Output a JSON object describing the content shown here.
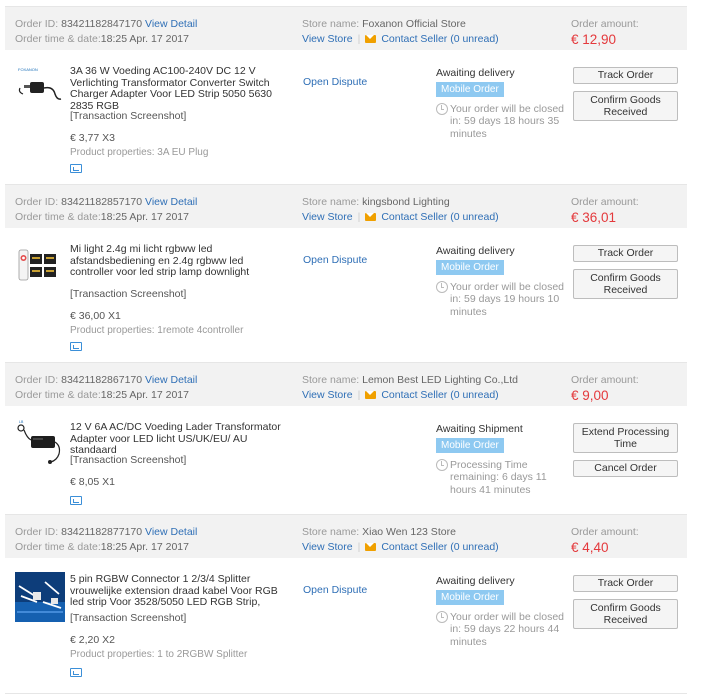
{
  "labels": {
    "order_id": "Order ID:",
    "order_time": "Order time & date:",
    "store_name": "Store name:",
    "view_detail": "View Detail",
    "view_store": "View Store",
    "contact_seller": "Contact Seller",
    "unread_open": "(",
    "unread_close": " unread)",
    "order_amount": "Order amount:",
    "transaction_screenshot": "[Transaction Screenshot]"
  },
  "orders": [
    {
      "order_id": "83421182847170",
      "order_time": "18:25 Apr. 17 2017",
      "store": "Foxanon Official Store",
      "unread": "0",
      "amount": "€ 12,90",
      "product_title": "3A 36 W Voeding AC100-240V DC 12 V Verlichting Transformator Converter Switch Charger Adapter Voor LED Strip 5050 5630 2835 RGB",
      "price_qty": "€ 3,77 X3",
      "properties": "Product properties: 3A EU Plug",
      "dispute": "Open Dispute",
      "status": "Awaiting delivery",
      "badge": "Mobile Order",
      "countdown": "Your order will be closed in: 59 days 18 hours 35 minutes",
      "button1": "Track Order",
      "button2": "Confirm Goods Received"
    },
    {
      "order_id": "83421182857170",
      "order_time": "18:25 Apr. 17 2017",
      "store": "kingsbond Lighting",
      "unread": "0",
      "amount": "€ 36,01",
      "product_title": "Mi light 2.4g mi licht rgbww led afstandsbediening en 2.4g rgbww led controller voor led strip lamp downlight",
      "price_qty": "€ 36,00 X1",
      "properties": "Product properties: 1remote 4controller",
      "dispute": "Open Dispute",
      "status": "Awaiting delivery",
      "badge": "Mobile Order",
      "countdown": "Your order will be closed in: 59 days 19 hours 10 minutes",
      "button1": "Track Order",
      "button2": "Confirm Goods Received"
    },
    {
      "order_id": "83421182867170",
      "order_time": "18:25 Apr. 17 2017",
      "store": "Lemon Best LED Lighting Co.,Ltd",
      "unread": "0",
      "amount": "€ 9,00",
      "product_title": "12 V 6A AC/DC Voeding Lader Transformator Adapter voor LED licht US/UK/EU/ AU standaard",
      "price_qty": "€ 8,05 X1",
      "status": "Awaiting Shipment",
      "badge": "Mobile Order",
      "countdown": "Processing Time remaining: 6 days 11 hours 41 minutes",
      "button1": "Extend Processing Time",
      "button2": "Cancel Order"
    },
    {
      "order_id": "83421182877170",
      "order_time": "18:25 Apr. 17 2017",
      "store": "Xiao Wen 123 Store",
      "unread": "0",
      "amount": "€ 4,40",
      "product_title": "5 pin RGBW Connector 1 2/3/4 Splitter vrouwelijke extension draad kabel Voor RGB led strip Voor 3528/5050 LED RGB Strip,",
      "price_qty": "€ 2,20 X2",
      "properties": "Product properties: 1 to 2RGBW Splitter",
      "dispute": "Open Dispute",
      "status": "Awaiting delivery",
      "badge": "Mobile Order",
      "countdown": "Your order will be closed in: 59 days 22 hours 44 minutes",
      "button1": "Track Order",
      "button2": "Confirm Goods Received"
    }
  ]
}
